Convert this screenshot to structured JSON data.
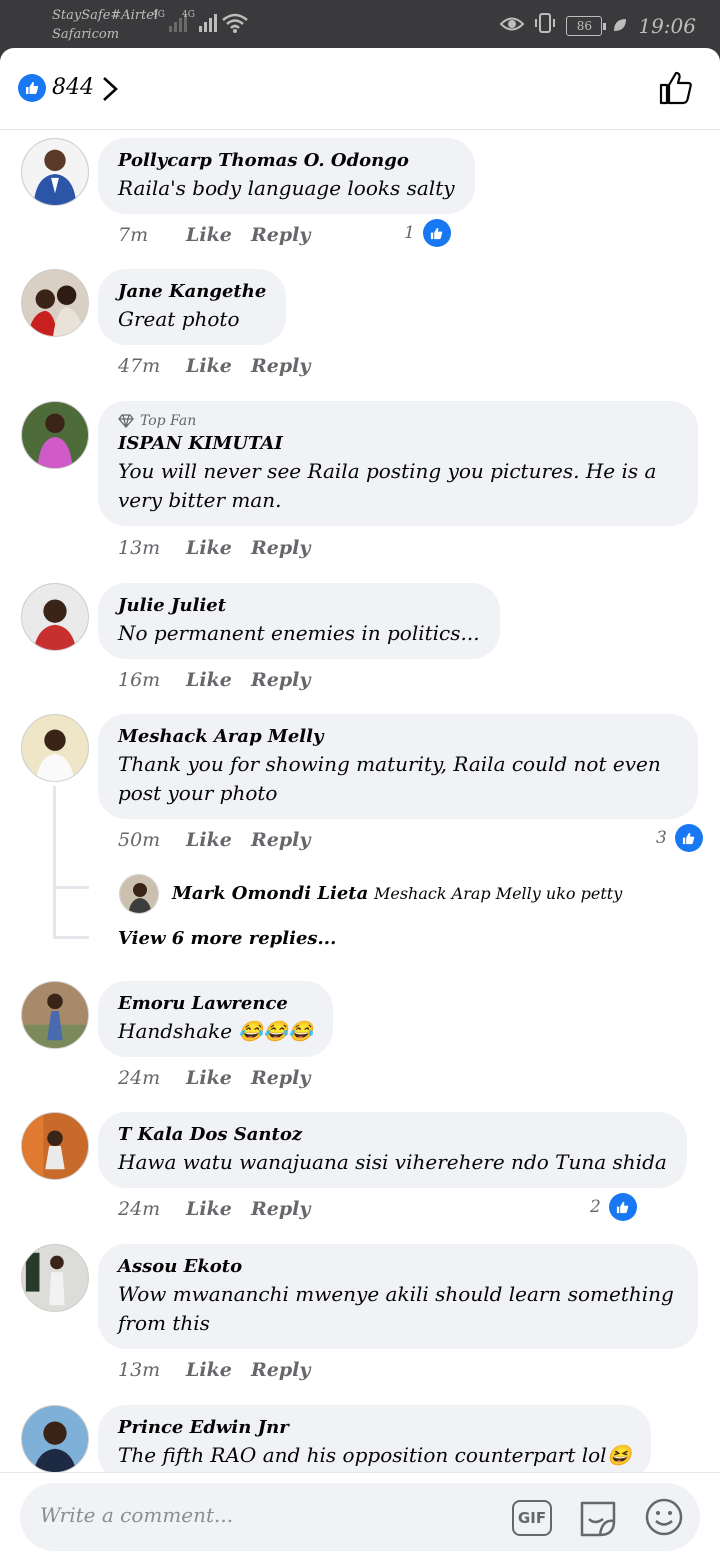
{
  "status_bar": {
    "carrier_line1": "StaySafe#Airtel",
    "carrier_line2": "Safaricom",
    "network1": "4G",
    "network2": "4G",
    "battery": "86",
    "time": "19:06"
  },
  "header": {
    "like_count": "844"
  },
  "comments": [
    {
      "author": "Pollycarp Thomas O. Odongo",
      "text": "Raila's body language looks salty",
      "time": "7m",
      "like": "Like",
      "reply": "Reply",
      "reactions": "1"
    },
    {
      "author": "Jane Kangethe",
      "text": "Great photo",
      "time": "47m",
      "like": "Like",
      "reply": "Reply"
    },
    {
      "badge": "Top Fan",
      "author": "ISPAN KIMUTAI",
      "text": "You will never see Raila posting you pictures. He is a very bitter man.",
      "time": "13m",
      "like": "Like",
      "reply": "Reply"
    },
    {
      "author": "Julie Juliet",
      "text": "No permanent enemies in politics...",
      "time": "16m",
      "like": "Like",
      "reply": "Reply"
    },
    {
      "author": "Meshack Arap Melly",
      "text": "Thank you for showing maturity, Raila could not even post your photo",
      "time": "50m",
      "like": "Like",
      "reply": "Reply",
      "reactions": "3",
      "reply_preview": {
        "author": "Mark Omondi Lieta",
        "text": "Meshack Arap Melly uko petty"
      },
      "more_replies": "View 6 more replies..."
    },
    {
      "author": "Emoru Lawrence",
      "text": "Handshake 😂😂😂",
      "time": "24m",
      "like": "Like",
      "reply": "Reply"
    },
    {
      "author": "T Kala Dos Santoz",
      "text": "Hawa watu wanajuana sisi viherehere ndo Tuna shida",
      "time": "24m",
      "like": "Like",
      "reply": "Reply",
      "reactions": "2"
    },
    {
      "author": "Assou Ekoto",
      "text": "Wow mwananchi mwenye akili should learn something from this",
      "time": "13m",
      "like": "Like",
      "reply": "Reply"
    },
    {
      "author": "Prince Edwin Jnr",
      "text": "The fifth RAO and his opposition counterpart lol😆"
    }
  ],
  "composer": {
    "placeholder": "Write a comment...",
    "gif_label": "GIF"
  },
  "colors": {
    "accent": "#1877f2",
    "bubble": "#f0f2f5",
    "meta": "#65676b"
  }
}
